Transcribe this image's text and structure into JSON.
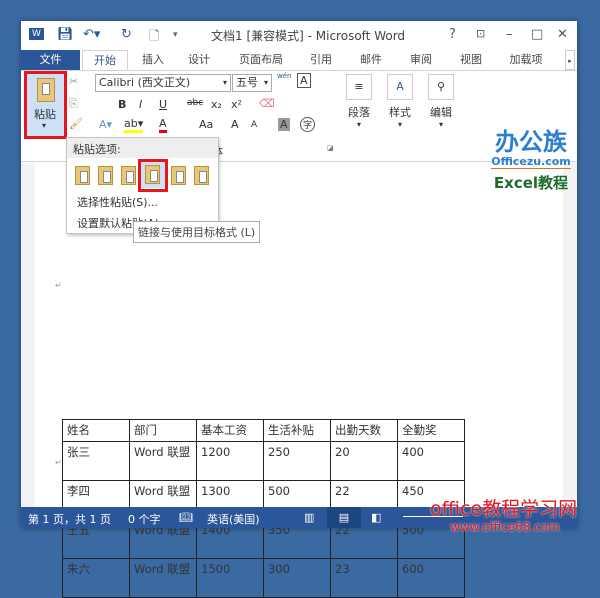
{
  "window": {
    "title": "文档1 [兼容模式] - Microsoft Word",
    "help": "?",
    "controls": [
      "restore-ribbon",
      "minimize",
      "maximize",
      "close"
    ]
  },
  "tabs": [
    "文件",
    "开始",
    "插入",
    "设计",
    "页面布局",
    "引用",
    "邮件",
    "审阅",
    "视图",
    "加载项"
  ],
  "active_tab": "开始",
  "ribbon": {
    "paste_label": "粘贴",
    "font_name": "Calibri (西文正文)",
    "font_size": "五号",
    "group_font": "字体",
    "paragraph": "段落",
    "styles": "样式",
    "editing": "编辑",
    "buttons": {
      "bold": "B",
      "italic": "I",
      "underline": "U",
      "strike": "abc",
      "sub": "x₂",
      "sup": "x²",
      "font_color": "A",
      "case": "Aa",
      "grow": "A",
      "shrink": "A",
      "shade": "A",
      "phonetic": "字",
      "wen": "wén",
      "char_border": "A"
    }
  },
  "paste_menu": {
    "header": "粘贴选项:",
    "items": [
      "选择性粘贴(S)...",
      "设置默认粘贴(A)..."
    ],
    "tooltip": "链接与使用目标格式 (L)",
    "options": [
      "keep-source-formatting",
      "merge-formatting",
      "link-keep-source",
      "link-use-destination",
      "picture",
      "keep-text-only"
    ]
  },
  "watermark": {
    "logo": "办公族",
    "site": "Officezu.com",
    "sub": "Excel教程",
    "footer1": "office教程学习网",
    "footer2": "www.office68.com"
  },
  "table": {
    "headers": [
      "姓名",
      "部门",
      "基本工资",
      "生活补贴",
      "出勤天数",
      "全勤奖"
    ],
    "rows": [
      [
        "张三",
        "Word 联盟",
        "1200",
        "250",
        "20",
        "400"
      ],
      [
        "李四",
        "Word 联盟",
        "1300",
        "500",
        "22",
        "450"
      ],
      [
        "王五",
        "Word 联盟",
        "1400",
        "350",
        "22",
        "500"
      ],
      [
        "朱六",
        "Word 联盟",
        "1500",
        "300",
        "23",
        "600"
      ]
    ]
  },
  "status": {
    "page": "第 1 页，共 1 页",
    "words": "0 个字",
    "language": "英语(美国)"
  },
  "colors": {
    "accent": "#2b579a",
    "highlight": "#e8141c",
    "background": "#3b6aa3"
  }
}
